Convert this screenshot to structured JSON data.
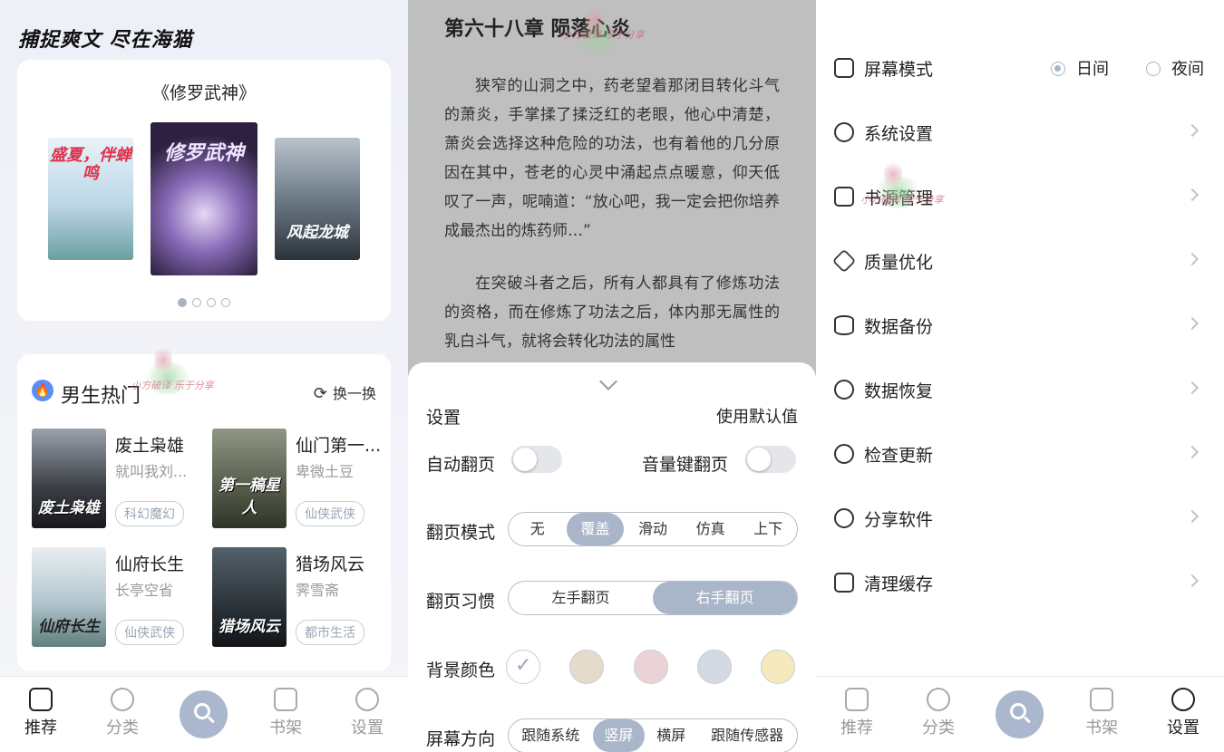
{
  "home": {
    "slogan": "捕捉爽文 尽在海猫",
    "featured_title": "《修罗武神》",
    "carousel": [
      {
        "cover_text": "盛夏，伴蝉鸣"
      },
      {
        "cover_text": "修罗武神"
      },
      {
        "cover_text": "风起龙城"
      }
    ],
    "hot_title": "男生热门",
    "refresh_label": "换一换",
    "books": [
      {
        "name": "废土枭雄",
        "author": "就叫我刘...",
        "tag": "科幻魔幻",
        "cover_text": "废土枭雄"
      },
      {
        "name": "仙门第一...",
        "author": "卑微土豆",
        "tag": "仙侠武侠",
        "cover_text": "第一稿星人"
      },
      {
        "name": "仙府长生",
        "author": "长亭空省",
        "tag": "仙侠武侠",
        "cover_text": "仙府长生"
      },
      {
        "name": "猎场风云",
        "author": "霁雪斋",
        "tag": "都市生活",
        "cover_text": "猎场风云"
      }
    ]
  },
  "tabbar": {
    "items": [
      {
        "label": "推荐"
      },
      {
        "label": "分类"
      },
      {
        "label": "书架"
      },
      {
        "label": "设置"
      }
    ]
  },
  "reader": {
    "chapter_title": "第六十八章 陨落心炎",
    "paragraphs": [
      "狭窄的山洞之中，药老望着那闭目转化斗气的萧炎，手掌揉了揉泛红的老眼，他心中清楚，萧炎会选择这种危险的功法，也有着他的几分原因在其中，苍老的心灵中涌起点点暖意，仰天低叹了一声，呢喃道：“放心吧，我一定会把你培养成最杰出的炼药师…”",
      "在突破斗者之后，所有人都具有了修炼功法的资格，而在修炼了功法之后，体内那无属性的乳白斗气，就将会转化功法的属性"
    ]
  },
  "settings_sheet": {
    "title": "设置",
    "reset_label": "使用默认值",
    "auto_turn_label": "自动翻页",
    "volume_key_label": "音量键翻页",
    "auto_turn_on": false,
    "volume_key_on": false,
    "turn_mode_label": "翻页模式",
    "turn_modes": [
      "无",
      "覆盖",
      "滑动",
      "仿真",
      "上下"
    ],
    "turn_mode_selected": "覆盖",
    "habit_label": "翻页习惯",
    "habits": [
      "左手翻页",
      "右手翻页"
    ],
    "habit_selected": "右手翻页",
    "bg_label": "背景颜色",
    "bg_colors": [
      "#ffffff",
      "#e4dccb",
      "#ead3d6",
      "#d3dae4",
      "#f5e9bd"
    ],
    "orientation_label": "屏幕方向",
    "orientations": [
      "跟随系统",
      "竖屏",
      "横屏",
      "跟随传感器"
    ],
    "orientation_selected": "竖屏"
  },
  "system_menu": {
    "screen_mode_label": "屏幕模式",
    "day_label": "日间",
    "night_label": "夜间",
    "screen_mode_selected": "日间",
    "items": [
      {
        "label": "系统设置",
        "icon": "gear-icon"
      },
      {
        "label": "书源管理",
        "icon": "bookmark-icon"
      },
      {
        "label": "质量优化",
        "icon": "diamond-icon"
      },
      {
        "label": "数据备份",
        "icon": "database-icon"
      },
      {
        "label": "数据恢复",
        "icon": "restore-icon"
      },
      {
        "label": "检查更新",
        "icon": "upload-icon"
      },
      {
        "label": "分享软件",
        "icon": "share-icon"
      },
      {
        "label": "清理缓存",
        "icon": "broom-icon"
      }
    ]
  },
  "watermark": {
    "text": "小方破译 乐于分享"
  },
  "colors": {
    "accent": "#a9b6c9",
    "reader_bg": "#bfbfbf"
  }
}
